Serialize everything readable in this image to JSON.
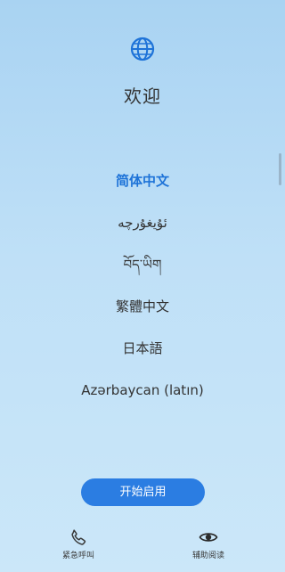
{
  "header": {
    "icon": "globe-icon",
    "title": "欢迎"
  },
  "languages": [
    {
      "label": "简体中文",
      "selected": true
    },
    {
      "label": "ئۇيغۇرچە",
      "selected": false
    },
    {
      "label": "བོད་ཡིག",
      "selected": false
    },
    {
      "label": "繁體中文",
      "selected": false
    },
    {
      "label": "日本語",
      "selected": false
    },
    {
      "label": "Azərbaycan (latın)",
      "selected": false
    }
  ],
  "start_button": {
    "label": "开始启用"
  },
  "bottom_bar": {
    "emergency": {
      "label": "紧急呼叫",
      "icon": "phone-icon"
    },
    "accessibility": {
      "label": "辅助阅读",
      "icon": "eye-icon"
    }
  },
  "colors": {
    "accent": "#2b7de2",
    "selected_text": "#1e73d8",
    "background_top": "#a9d3f2",
    "background_bottom": "#cbe7f9"
  }
}
